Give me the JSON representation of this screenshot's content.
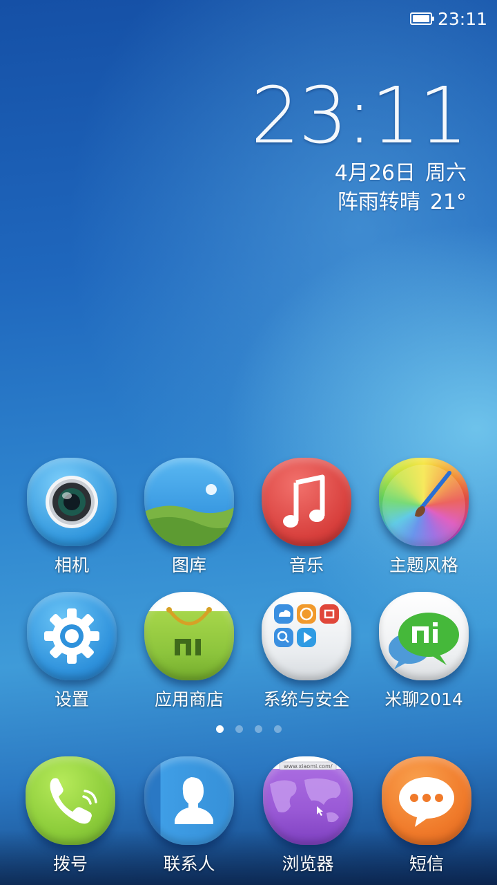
{
  "status_bar": {
    "time": "23:11",
    "battery_level": 1.0,
    "icons": [
      "battery-icon"
    ]
  },
  "clock_widget": {
    "time": "23:11",
    "date": "4月26日",
    "weekday": "周六",
    "weather": "阵雨转晴",
    "temperature": "21°"
  },
  "apps": [
    {
      "label": "相机",
      "icon": "camera-icon"
    },
    {
      "label": "图库",
      "icon": "gallery-icon"
    },
    {
      "label": "音乐",
      "icon": "music-icon"
    },
    {
      "label": "主题风格",
      "icon": "theme-brush-icon"
    },
    {
      "label": "设置",
      "icon": "settings-gear-icon"
    },
    {
      "label": "应用商店",
      "icon": "app-store-bag-icon"
    },
    {
      "label": "系统与安全",
      "icon": "system-security-folder-icon"
    },
    {
      "label": "米聊2014",
      "icon": "miliao-chat-icon"
    }
  ],
  "page_indicator": {
    "count": 4,
    "active": 0
  },
  "dock": [
    {
      "label": "拨号",
      "icon": "phone-icon"
    },
    {
      "label": "联系人",
      "icon": "contacts-icon"
    },
    {
      "label": "浏览器",
      "icon": "browser-icon",
      "url_text": "www.xiaomi.com/"
    },
    {
      "label": "短信",
      "icon": "message-icon"
    }
  ],
  "colors": {
    "camera": "#3fa6e6",
    "gallery_sky": "#46a9ea",
    "gallery_grass": "#6aa23a",
    "music": "#d9413f",
    "settings": "#3a9de0",
    "store": "#8cc43c",
    "phone": "#8ccc3a",
    "contacts": "#3690d8",
    "browser": "#9a5ad6",
    "sms": "#f07a2a"
  }
}
